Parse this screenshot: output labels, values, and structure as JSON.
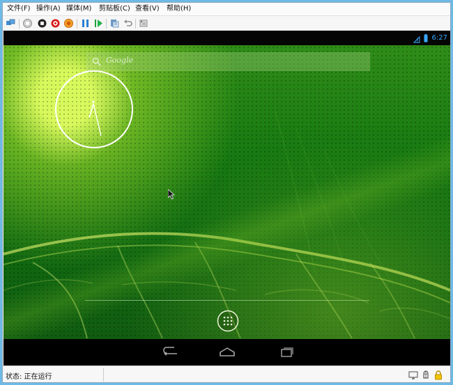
{
  "menu": {
    "items": [
      {
        "label": "文件(F)"
      },
      {
        "label": "操作(A)"
      },
      {
        "label": "媒体(M)"
      },
      {
        "label": "剪贴板(C)"
      },
      {
        "label": "查看(V)"
      },
      {
        "label": "帮助(H)"
      }
    ]
  },
  "toolbar": {
    "buttons": [
      {
        "icon": "vm-connection-icon"
      },
      {
        "icon": "stop-icon"
      },
      {
        "icon": "turn-off-icon"
      },
      {
        "icon": "shutdown-icon"
      },
      {
        "icon": "save-state-icon"
      },
      {
        "icon": "pause-icon"
      },
      {
        "icon": "resume-icon"
      },
      {
        "icon": "checkpoint-icon"
      },
      {
        "icon": "revert-icon"
      },
      {
        "icon": "settings-icon"
      }
    ]
  },
  "android": {
    "status_bar": {
      "time": "6:27",
      "icons": [
        "signal-icon",
        "battery-icon"
      ]
    },
    "search_bar": {
      "label": "Google"
    },
    "clock": {
      "type": "analog"
    },
    "navbar": {
      "buttons": [
        "back-icon",
        "home-icon",
        "recents-icon"
      ]
    }
  },
  "status_bar": {
    "text": "状态: 正在运行",
    "icons": [
      "monitor-icon",
      "keyboard-icon",
      "lock-icon"
    ]
  },
  "colors": {
    "window_bg": "#f0f0f0",
    "android_blue": "#39a7ff",
    "wallpaper_green": "#177a11"
  }
}
